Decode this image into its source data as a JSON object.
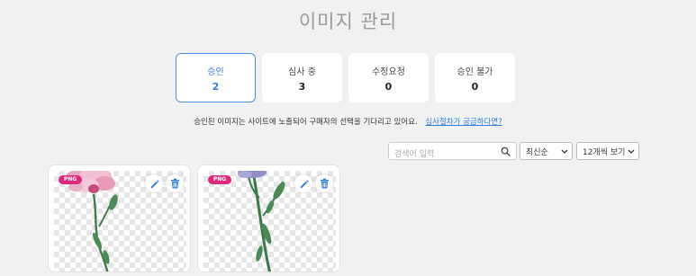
{
  "page": {
    "title": "이미지 관리"
  },
  "tabs": [
    {
      "label": "승인",
      "count": "2",
      "active": true
    },
    {
      "label": "심사 중",
      "count": "3",
      "active": false
    },
    {
      "label": "수정요청",
      "count": "0",
      "active": false
    },
    {
      "label": "승인 불가",
      "count": "0",
      "active": false
    }
  ],
  "info": {
    "message": "승인된 이미지는 사이트에 노출되어 구매자의 선택을 기다리고 있어요.",
    "help_link": "심사절차가 궁금하다면?"
  },
  "filters": {
    "search_placeholder": "검색어 입력",
    "sort_value": "최신순",
    "per_page_value": "12개씩 보기"
  },
  "images": [
    {
      "format_badge": "PNG",
      "flower_color": "#e7a6c0"
    },
    {
      "format_badge": "PNG",
      "flower_color": "#8e8fc6"
    }
  ],
  "colors": {
    "accent": "#2f7fd8",
    "badge": "#e0277c",
    "edit_icon": "#2f7fd8",
    "delete_icon": "#2f7fd8"
  },
  "icons": {
    "search": "search-icon",
    "edit": "pencil-icon",
    "delete": "trash-icon",
    "dropdown": "chevron-down-icon"
  }
}
